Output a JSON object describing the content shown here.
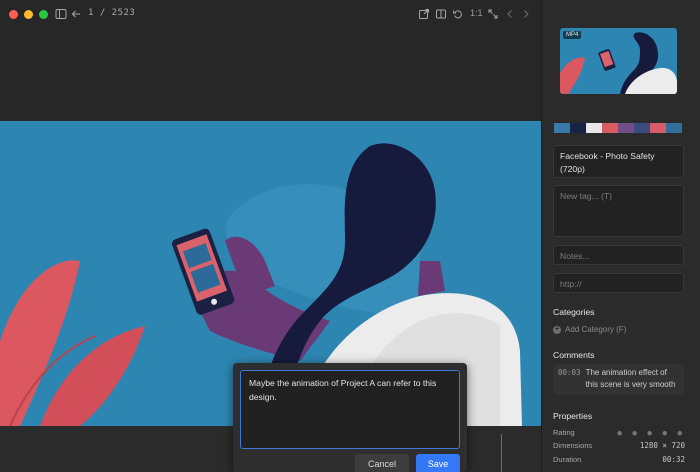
{
  "toolbar": {
    "counter": "1 / 2523",
    "zoom_text": "1:1"
  },
  "comment_popup": {
    "text": "Maybe the animation of Project A can refer to this design.",
    "cancel_label": "Cancel",
    "save_label": "Save"
  },
  "sidebar": {
    "thumbnail_badge": "MP4",
    "palette": [
      "#3a7aa9",
      "#142443",
      "#e7e7e7",
      "#d95c63",
      "#714e86",
      "#3e497e",
      "#d75e69",
      "#2f6f9a"
    ],
    "title_field": "Facebook - Photo Safety (720p)",
    "tag_placeholder": "New tag... (T)",
    "notes_placeholder": "Notes...",
    "url_placeholder": "http://",
    "categories_title": "Categories",
    "add_category_label": "Add Category (F)",
    "comments_title": "Comments",
    "comment": {
      "time": "00:03",
      "text": "The animation effect of this scene is very smooth"
    },
    "properties_title": "Properties",
    "properties": [
      {
        "label": "Rating",
        "value": "● ● ● ● ●"
      },
      {
        "label": "Dimensions",
        "value": "1280 × 720"
      },
      {
        "label": "Duration",
        "value": "00:32"
      }
    ]
  },
  "colors": {
    "accent": "#3478f6",
    "playhead": "#e0443a",
    "illustration_bg": "#2d86b1",
    "hair": "#161a3d",
    "shirt": "#ececec",
    "leaf": "#dc5860"
  }
}
